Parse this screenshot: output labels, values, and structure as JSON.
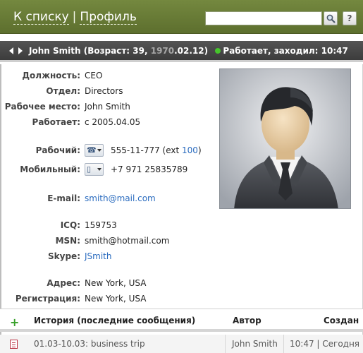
{
  "header": {
    "back_link": "К списку",
    "separator": "|",
    "profile_link": "Профиль",
    "search_placeholder": ""
  },
  "person_bar": {
    "name": "John Smith",
    "age_prefix": "(Возраст: 39, ",
    "birth_year": "1970",
    "birth_rest": ".02.12)",
    "status": "Работает, заходил: 10:47"
  },
  "fields": {
    "position_label": "Должность:",
    "position_value": "CEO",
    "department_label": "Отдел:",
    "department_value": "Directors",
    "workplace_label": "Рабочее место:",
    "workplace_value": "John Smith",
    "works_since_label": "Работает:",
    "works_since_value": "с 2005.04.05",
    "work_phone_label": "Рабочий:",
    "work_phone_value": "555-11-777 (ext ",
    "work_phone_ext": "100",
    "work_phone_close": ")",
    "mobile_label": "Мобильный:",
    "mobile_value": "+7 971 25835789",
    "email_label": "E-mail:",
    "email_value": "smith@mail.com",
    "icq_label": "ICQ:",
    "icq_value": "159753",
    "msn_label": "MSN:",
    "msn_value": "smith@hotmail.com",
    "skype_label": "Skype:",
    "skype_value": "JSmith",
    "address_label": "Адрес:",
    "address_value": "New York, USA",
    "registration_label": "Регистрация:",
    "registration_value": "New York, USA"
  },
  "history": {
    "col_history": "История (последние сообщения)",
    "col_author": "Автор",
    "col_created": "Создан",
    "rows": [
      {
        "text": "01.03-10.03: business trip",
        "author": "John Smith",
        "created": "10:47 | Сегодня"
      }
    ]
  },
  "icons": {
    "nav": [
      "arrow-left-icon",
      "arrow-right-icon"
    ],
    "search": "magnifier-icon",
    "help": "question-icon",
    "status": "online-dot-icon",
    "work_phone": "desk-phone-icon",
    "mobile": "mobile-phone-icon",
    "add": "plus-icon",
    "history_row": "document-icon",
    "photo": "avatar-illustration"
  },
  "colors": {
    "header_bg": "#6b7f36",
    "person_bar_bg": "#4a4a4a",
    "link": "#2b6cbf",
    "status_online": "#46c52c",
    "plus": "#39a12b"
  }
}
